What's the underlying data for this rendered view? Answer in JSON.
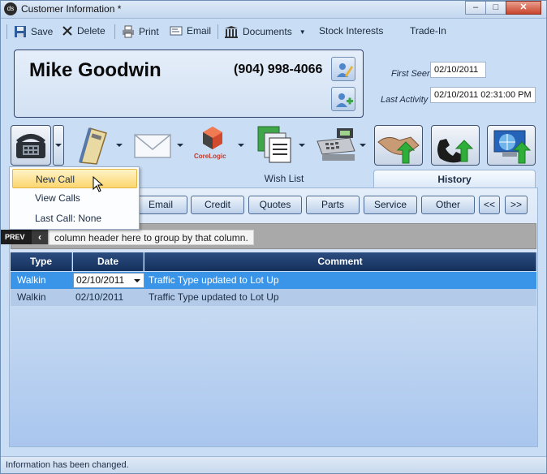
{
  "window": {
    "title": "Customer Information *",
    "app_icon_text": "ds"
  },
  "toolbar": {
    "save": "Save",
    "delete": "Delete",
    "print": "Print",
    "email": "Email",
    "documents": "Documents",
    "stock_interests": "Stock Interests",
    "trade_in": "Trade-In"
  },
  "customer": {
    "name": "Mike Goodwin",
    "phone": "(904) 998-4066",
    "first_seen_label": "First Seen",
    "first_seen": "02/10/2011",
    "last_activity_label": "Last Activity",
    "last_activity": "02/10/2011 02:31:00 PM"
  },
  "action_icons": {
    "corelogic_label": "CoreLogic"
  },
  "tabs": [
    {
      "label": "Wish List"
    },
    {
      "label": "History",
      "active": true
    }
  ],
  "filters": [
    "Email",
    "Credit",
    "Quotes",
    "Parts",
    "Service",
    "Other",
    "<<",
    ">>"
  ],
  "group_hint": "column header here to group by that column.",
  "prev_tag": "PREV",
  "grid": {
    "columns": [
      "Type",
      "Date",
      "Comment"
    ],
    "rows": [
      {
        "type": "Walkin",
        "date": "02/10/2011",
        "comment": "Traffic Type updated to Lot Up",
        "selected": true
      },
      {
        "type": "Walkin",
        "date": "02/10/2011",
        "comment": "Traffic Type updated to Lot Up",
        "selected": false
      }
    ]
  },
  "call_menu": {
    "items": [
      "New Call",
      "View Calls",
      "Last Call: None"
    ],
    "hovered_index": 0
  },
  "status": "Information has been changed.",
  "colors": {
    "accent": "#3a95e8",
    "header_dark": "#14305c",
    "panel": "#c9ddf4"
  }
}
